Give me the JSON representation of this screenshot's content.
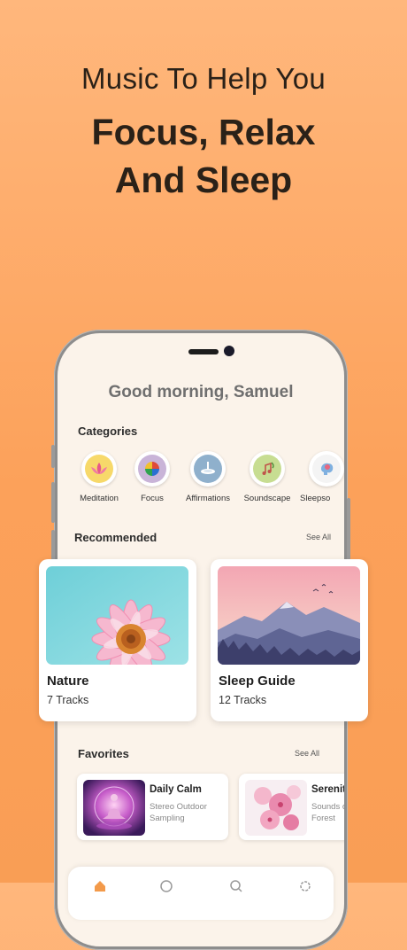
{
  "hero": {
    "line1": "Music To Help You",
    "line2": "Focus, Relax",
    "line3": "And Sleep"
  },
  "app": {
    "greeting": "Good morning, Samuel",
    "categories_title": "Categories",
    "categories": [
      {
        "label": "Meditation",
        "icon": "lotus-icon",
        "bg": "#f7d96a"
      },
      {
        "label": "Focus",
        "icon": "color-wheel-icon",
        "bg": "#c9b4d8"
      },
      {
        "label": "Affirmations",
        "icon": "fountain-icon",
        "bg": "#8fb0cc"
      },
      {
        "label": "Soundscape",
        "icon": "music-plant-icon",
        "bg": "#c7dd92"
      },
      {
        "label": "Sleepsounds",
        "icon": "brain-icon",
        "bg": "#f4f4f4"
      }
    ],
    "recommended_title": "Recommended",
    "recommended_see_all": "See All",
    "recommended": [
      {
        "title": "Nature",
        "subtitle": "7 Tracks",
        "image": "pink-flower-image"
      },
      {
        "title": "Sleep Guide",
        "subtitle": "12 Tracks",
        "image": "mountain-sunset-image"
      }
    ],
    "favorites_title": "Favorites",
    "favorites_see_all": "See All",
    "favorites": [
      {
        "title": "Daily Calm",
        "line1": "Stereo Outdoor",
        "line2": "Sampling",
        "image": "meditation-aura-image"
      },
      {
        "title": "Serenity",
        "line1": "Sounds of",
        "line2": "Forest",
        "image": "cherry-blossom-image"
      }
    ]
  },
  "colors": {
    "background": "#fca15a",
    "phone_screen": "#fbf3ea",
    "accent": "#f39a4a"
  }
}
